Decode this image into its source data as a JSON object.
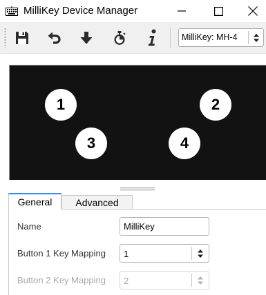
{
  "window": {
    "title": "MilliKey Device Manager",
    "app_icon": "keyboard-icon",
    "controls": [
      "minimize-icon",
      "maximize-icon",
      "close-icon"
    ]
  },
  "toolbar": {
    "buttons": [
      "save-icon",
      "undo-icon",
      "download-icon",
      "timer-icon",
      "info-icon"
    ],
    "device_select": {
      "value": "MilliKey: MH-4"
    }
  },
  "keypad": {
    "background": "#121212",
    "keys": [
      {
        "label": "1"
      },
      {
        "label": "2"
      },
      {
        "label": "3"
      },
      {
        "label": "4"
      }
    ]
  },
  "tabs": [
    {
      "label": "General",
      "active": true
    },
    {
      "label": "Advanced",
      "active": false
    }
  ],
  "general": {
    "name_label": "Name",
    "name_value": "MilliKey",
    "button1_label": "Button 1 Key Mapping",
    "button1_value": "1",
    "button2_label": "Button 2 Key Mapping",
    "button2_value": "2",
    "button2_disabled": true
  },
  "colors": {
    "accent": "#3c8ee5",
    "toolbar_bg": "#f0f0f0",
    "disabled_text": "#a8a8a8"
  }
}
